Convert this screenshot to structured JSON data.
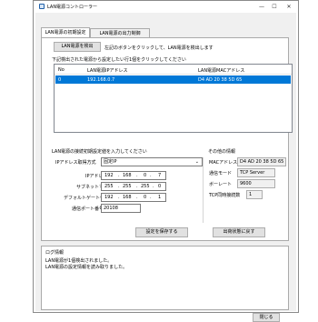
{
  "window": {
    "title": "LAN電源コントローラー",
    "minimize_glyph": "—",
    "maximize_glyph": "☐",
    "close_glyph": "✕"
  },
  "tabs": [
    {
      "label": "LAN電源の初期設定"
    },
    {
      "label": "LAN電源の出力制御"
    }
  ],
  "detect": {
    "button_label": "LAN電源を検出",
    "instruction": "左記のボタンをクリックして、LAN電源を検出します",
    "list_caption": "下記検出された電源から設定したい行1個をクリックしてください"
  },
  "list": {
    "columns": [
      "No",
      "LAN電源IPアドレス",
      "LAN電源MACアドレス"
    ],
    "rows": [
      {
        "no": "0",
        "ip": "192.168.0.7",
        "mac": "D4 AD 20 38 5D 65"
      }
    ]
  },
  "config": {
    "section_label": "LAN電源の接続初期設定値を入力してください",
    "ip_mode_label": "IPアドレス取得方式",
    "ip_mode_value": "固定IP",
    "ip_label": "IPアドレス",
    "ip_octets": [
      "192",
      "168",
      "0",
      "7"
    ],
    "subnet_label": "サブネットマスク",
    "subnet_octets": [
      "255",
      "255",
      "255",
      "0"
    ],
    "gateway_label": "デフォルトゲートウェイ",
    "gateway_octets": [
      "192",
      "168",
      "0",
      "1"
    ],
    "port_label": "通信ポート番号",
    "port_value": "20108"
  },
  "other": {
    "section_label": "その他の情報",
    "mac_label": "MACアドレス",
    "mac_value": "D4 AD 20 38 5D 65",
    "mode_label": "通信モード",
    "mode_value": "TCP Server",
    "baud_label": "ボーレート",
    "baud_value": "9600",
    "tcp_label": "TCP同時接続数",
    "tcp_value": "1"
  },
  "actions": {
    "save_label": "設定を保存する",
    "reset_label": "出荷状態に戻す"
  },
  "log": {
    "title": "ログ情報",
    "lines": [
      "LAN電源が1個検出されました。",
      "LAN電源の設定情報を読み取りました。"
    ]
  },
  "footer": {
    "close_label": "閉じる"
  },
  "colors": {
    "selection": "#0078d7",
    "client_bg": "#f0f0f0"
  }
}
